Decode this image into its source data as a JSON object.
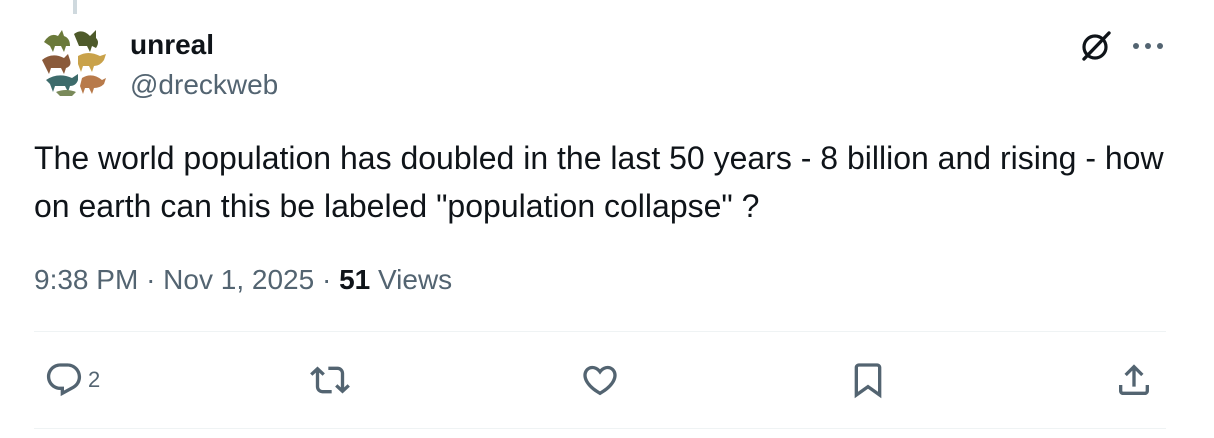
{
  "author": {
    "display_name": "unreal",
    "handle": "@dreckweb"
  },
  "tweet": {
    "text": "The world population has doubled in the last 50 years - 8 billion and rising - how on earth can this be labeled \"population collapse\" ?",
    "time": "9:38 PM",
    "date": "Nov 1, 2025",
    "views_count": "51",
    "views_label": "Views",
    "separator": "·"
  },
  "actions": {
    "reply_count": "2"
  },
  "icons": {
    "reply": "reply-icon",
    "retweet": "retweet-icon",
    "like": "heart-icon",
    "bookmark": "bookmark-icon",
    "share": "share-icon",
    "grok": "grok-icon",
    "more": "more-icon"
  },
  "colors": {
    "text": "#0f1419",
    "secondary": "#536471",
    "divider": "#eff3f4"
  }
}
